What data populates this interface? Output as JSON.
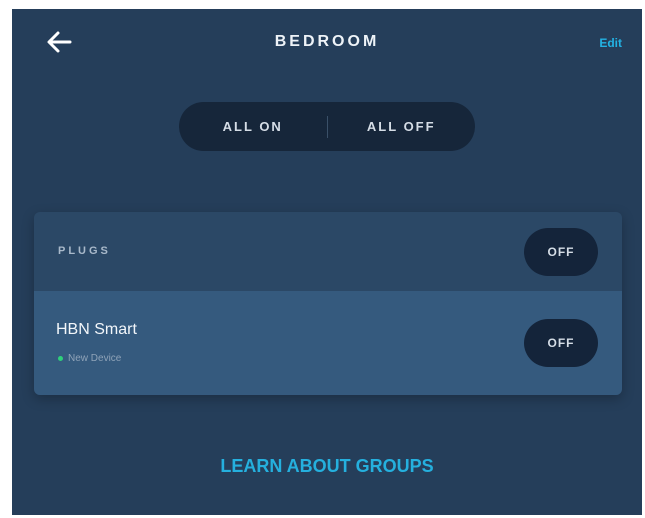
{
  "header": {
    "back_icon": "arrow-left-icon",
    "title": "BEDROOM",
    "edit_label": "Edit"
  },
  "group_controls": {
    "all_on_label": "ALL ON",
    "all_off_label": "ALL OFF"
  },
  "plugs_section": {
    "label": "PLUGS",
    "group_toggle_label": "OFF",
    "devices": [
      {
        "name": "HBN Smart",
        "status": "New Device",
        "status_color": "#2fd07a",
        "toggle_label": "OFF"
      }
    ]
  },
  "footer": {
    "learn_label": "LEARN ABOUT GROUPS"
  },
  "colors": {
    "background": "#253e5a",
    "accent": "#25b0de",
    "pill": "#14243a"
  }
}
